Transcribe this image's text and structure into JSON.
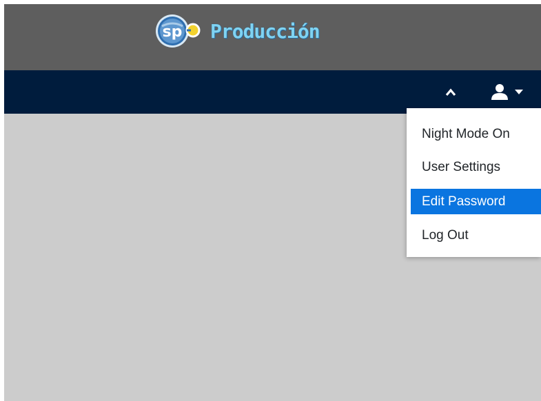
{
  "header": {
    "brand_text": "Producción",
    "brand_badge": "sp",
    "background_color": "#5e5e5e",
    "brand_color": "#7fd3f2"
  },
  "navbar": {
    "background_color": "#001c3d",
    "collapse_icon": "chevron-up-icon",
    "user_icon": "user-icon",
    "caret_icon": "caret-down-icon"
  },
  "user_menu": {
    "items": [
      {
        "label": "Night Mode On",
        "active": false
      },
      {
        "label": "User Settings",
        "active": false
      },
      {
        "label": "Edit Password",
        "active": true
      },
      {
        "label": "Log Out",
        "active": false
      }
    ],
    "active_color": "#0a75e0"
  },
  "content": {
    "background_color": "#cccccc"
  }
}
